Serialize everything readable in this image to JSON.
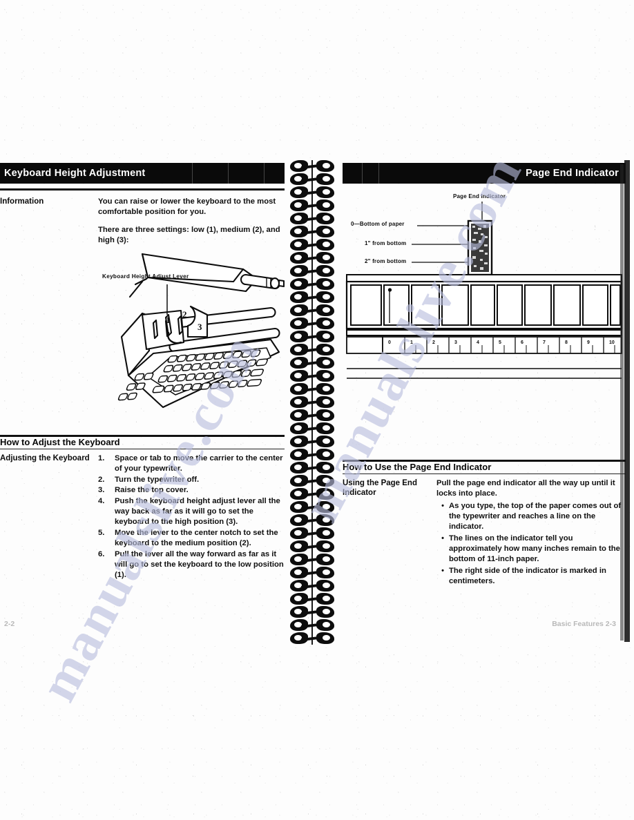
{
  "document": {
    "kind": "scanned-manual-spread",
    "watermark_text": "manualslive.com"
  },
  "left_page": {
    "header_title": "Keyboard Height Adjustment",
    "info": {
      "label": "Information",
      "paragraphs": [
        "You can raise or lower the keyboard to the most comfortable position for you.",
        "There are three settings: low (1), medium (2), and high (3):"
      ]
    },
    "illustration": {
      "lever_label": "Keyboard Height Adjust Lever",
      "position_markers": [
        "1",
        "2",
        "3"
      ]
    },
    "section": {
      "heading": "How to Adjust the Keyboard",
      "label": "Adjusting the Keyboard",
      "steps": [
        {
          "num": "1.",
          "text": "Space or tab to move the carrier to the center of your typewriter."
        },
        {
          "num": "2.",
          "text": "Turn the typewriter off."
        },
        {
          "num": "3.",
          "text": "Raise the top cover."
        },
        {
          "num": "4.",
          "text": "Push the keyboard height adjust lever all the way back as far as it will go to set the keyboard to the high position (3)."
        },
        {
          "num": "5.",
          "text": "Move the lever to the center notch to set the keyboard to the medium position (2)."
        },
        {
          "num": "6.",
          "text": "Pull the lever all the way forward as far as it will go to set the keyboard to the low position (1)."
        }
      ]
    },
    "folio": "2-2"
  },
  "right_page": {
    "header_title": "Page End Indicator",
    "illustration": {
      "title_caption": "Page End Indicator",
      "callouts": [
        "0—Bottom of paper",
        "1\" from bottom",
        "2\" from bottom"
      ],
      "ruler_ticks": [
        "0",
        "1",
        "2",
        "3",
        "4",
        "5",
        "6",
        "7",
        "8",
        "9",
        "10"
      ]
    },
    "section": {
      "heading": "How to Use the Page End Indicator",
      "label": "Using the Page End Indicator",
      "intro": "Pull the page end indicator all the way up until it locks into place.",
      "bullets": [
        "As you type, the top of the paper comes out of the typewriter and reaches a line on the indicator.",
        "The lines on the indicator tell you approximately how many inches remain to the bottom of 11-inch paper.",
        "The right side of the indicator is marked in centimeters."
      ]
    },
    "folio": "Basic Features   2-3"
  }
}
